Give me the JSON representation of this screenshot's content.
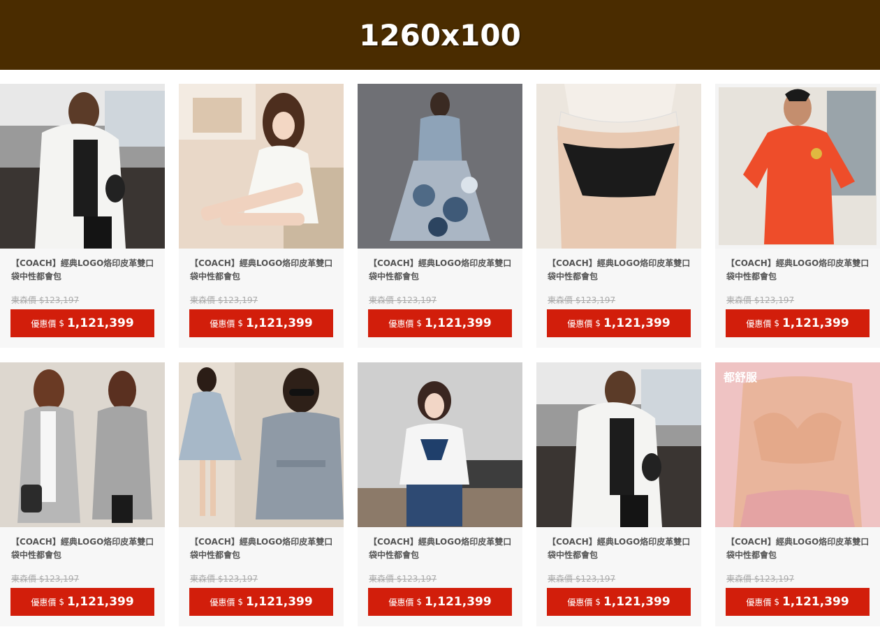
{
  "banner": {
    "text": "1260x100"
  },
  "colors": {
    "banner_bg": "#4a2c00",
    "price_button": "#d21e0b",
    "card_bg": "#f7f7f7"
  },
  "products": [
    {
      "image": "woman-white-coat-photo",
      "title": "【COACH】經典LOGO烙印皮革雙口袋中性都會包",
      "orig_label": "東森價",
      "orig_price": "$123,197",
      "price_label": "優惠價",
      "currency": "$",
      "price": "1,121,399"
    },
    {
      "image": "woman-white-lingerie-photo",
      "title": "【COACH】經典LOGO烙印皮革雙口袋中性都會包",
      "orig_label": "東森價",
      "orig_price": "$123,197",
      "price_label": "優惠價",
      "currency": "$",
      "price": "1,121,399"
    },
    {
      "image": "woman-floral-dress-photo",
      "title": "【COACH】經典LOGO烙印皮革雙口袋中性都會包",
      "orig_label": "東森價",
      "orig_price": "$123,197",
      "price_label": "優惠價",
      "currency": "$",
      "price": "1,121,399"
    },
    {
      "image": "black-underwear-photo",
      "title": "【COACH】經典LOGO烙印皮革雙口袋中性都會包",
      "orig_label": "東森價",
      "orig_price": "$123,197",
      "price_label": "優惠價",
      "currency": "$",
      "price": "1,121,399"
    },
    {
      "image": "man-orange-polo-photo",
      "title": "【COACH】經典LOGO烙印皮革雙口袋中性都會包",
      "orig_label": "東森價",
      "orig_price": "$123,197",
      "price_label": "優惠價",
      "currency": "$",
      "price": "1,121,399"
    },
    {
      "image": "two-women-grey-coats-photo",
      "title": "【COACH】經典LOGO烙印皮革雙口袋中性都會包",
      "orig_label": "東森價",
      "orig_price": "$123,197",
      "price_label": "優惠價",
      "currency": "$",
      "price": "1,121,399"
    },
    {
      "image": "women-grey-dresses-photo",
      "title": "【COACH】經典LOGO烙印皮革雙口袋中性都會包",
      "orig_label": "東森價",
      "orig_price": "$123,197",
      "price_label": "優惠價",
      "currency": "$",
      "price": "1,121,399"
    },
    {
      "image": "woman-white-sweater-photo",
      "title": "【COACH】經典LOGO烙印皮革雙口袋中性都會包",
      "orig_label": "東森價",
      "orig_price": "$123,197",
      "price_label": "優惠價",
      "currency": "$",
      "price": "1,121,399"
    },
    {
      "image": "woman-white-coat-photo",
      "title": "【COACH】經典LOGO烙印皮革雙口袋中性都會包",
      "orig_label": "東森價",
      "orig_price": "$123,197",
      "price_label": "優惠價",
      "currency": "$",
      "price": "1,121,399"
    },
    {
      "image": "woman-pink-bra-photo",
      "overlay_text": "都舒服",
      "title": "【COACH】經典LOGO烙印皮革雙口袋中性都會包",
      "orig_label": "東森價",
      "orig_price": "$123,197",
      "price_label": "優惠價",
      "currency": "$",
      "price": "1,121,399"
    }
  ]
}
